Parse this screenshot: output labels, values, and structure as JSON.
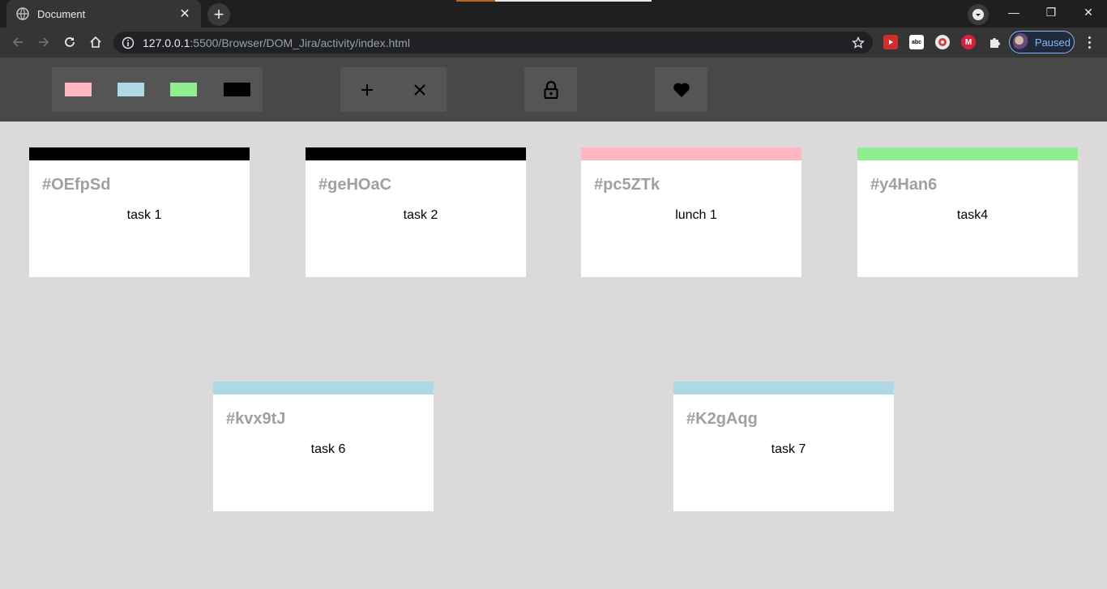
{
  "browser": {
    "tab_title": "Document",
    "tab_close": "✕",
    "new_tab": "+",
    "url_host": "127.0.0.1",
    "url_rest": ":5500/Browser/DOM_Jira/activity/index.html",
    "profile_status": "Paused",
    "window_buttons": {
      "minimize": "—",
      "restore": "❐",
      "close": "✕"
    }
  },
  "toolbar": {
    "colors": [
      "#ffb6c1",
      "#add8e6",
      "#90ee90",
      "#000000"
    ],
    "add_label": "+",
    "remove_label": "✕",
    "lock_icon": "lock-icon",
    "heart_icon": "heart-icon"
  },
  "tickets": [
    {
      "id": "#OEfpSd",
      "task": "task 1",
      "color": "#000000"
    },
    {
      "id": "#geHOaC",
      "task": "task 2",
      "color": "#000000"
    },
    {
      "id": "#pc5ZTk",
      "task": "lunch 1",
      "color": "#ffb6c1"
    },
    {
      "id": "#y4Han6",
      "task": "task4",
      "color": "#90ee90"
    },
    {
      "id": "#kvx9tJ",
      "task": "task 6",
      "color": "#add8e6"
    },
    {
      "id": "#K2gAqg",
      "task": "task 7",
      "color": "#add8e6"
    }
  ]
}
